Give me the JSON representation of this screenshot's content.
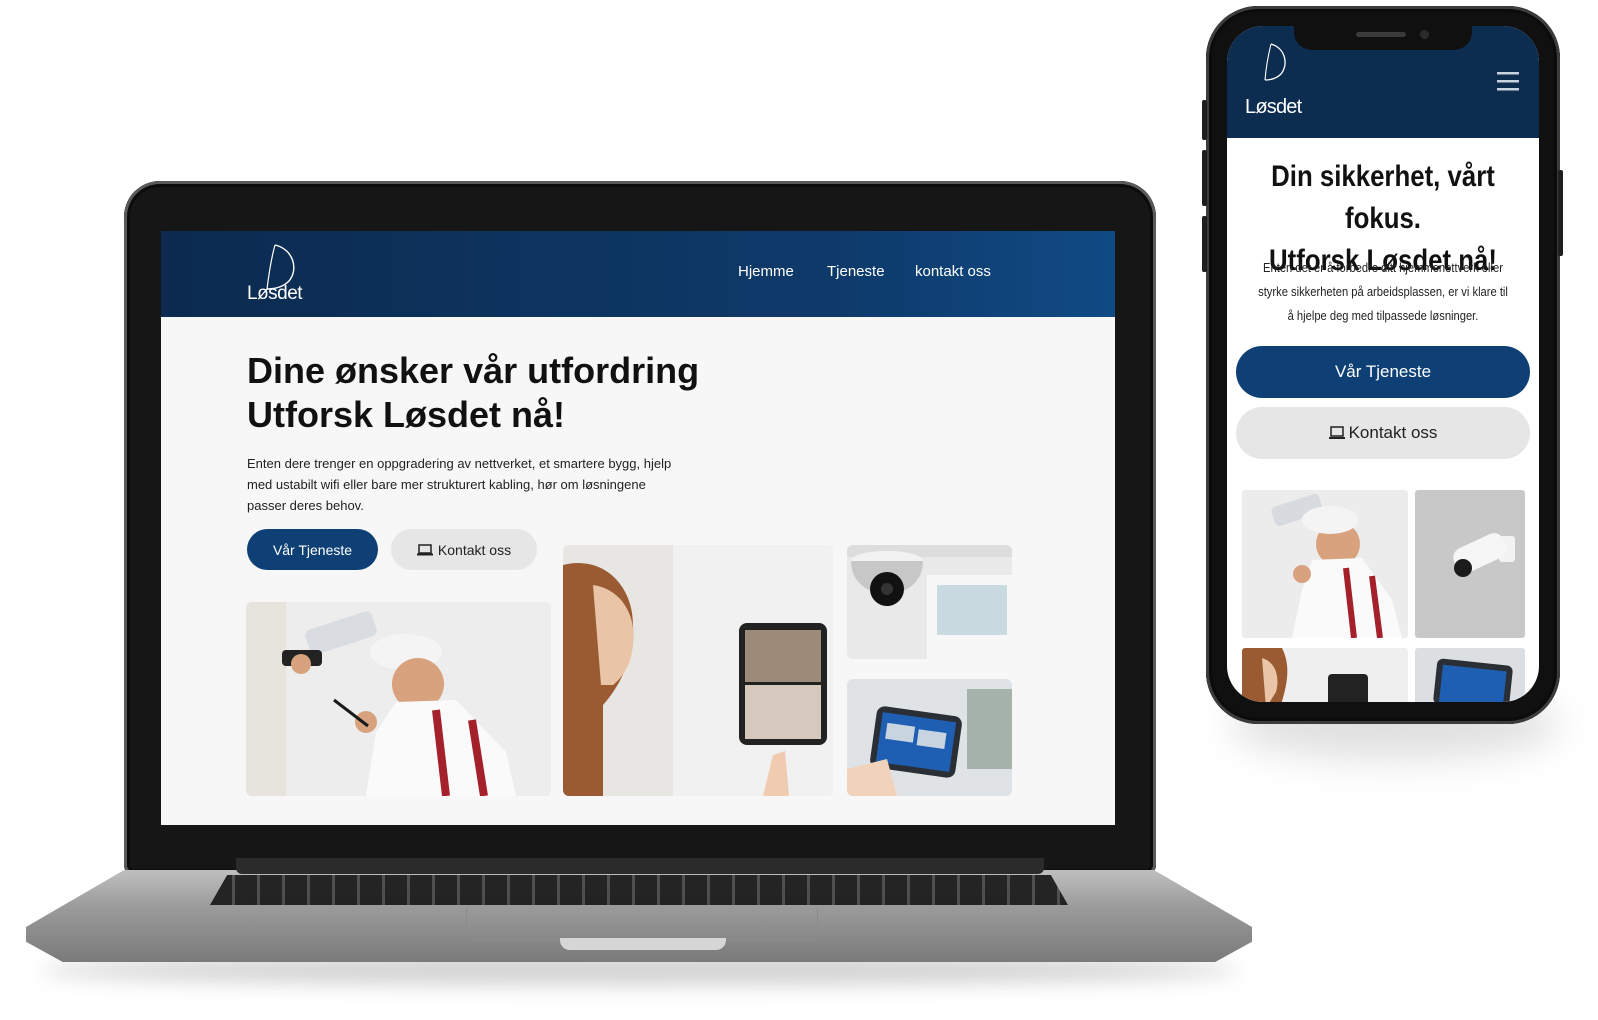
{
  "brand": {
    "name": "Løsdet",
    "primary": "#0f4075",
    "header_bg": "#0c2a4f",
    "light_button_bg": "#e6e6e6"
  },
  "desktop": {
    "nav": {
      "items": [
        "Hjemme",
        "Tjeneste",
        "kontakt oss"
      ]
    },
    "hero": {
      "title_line1": "Dine ønsker vår utfordring",
      "title_line2": "Utforsk Løsdet nå!",
      "text": "Enten dere trenger en oppgradering av nettverket, et smartere bygg, hjelp med ustabilt wifi eller bare mer strukturert kabling, hør om løsningene passer deres behov.",
      "primary_button": "Vår Tjeneste",
      "secondary_button": "Kontakt oss",
      "secondary_icon": "laptop-icon"
    },
    "gallery_icons": [
      "technician-camera-photo",
      "woman-tablet-photo",
      "dome-camera-photo",
      "tablet-security-app-photo"
    ]
  },
  "mobile": {
    "menu_icon": "hamburger-menu-icon",
    "hero": {
      "title_line1": "Din sikkerhet, vårt fokus.",
      "title_line2": "Utforsk Løsdet nå!",
      "text": "Enten det er å forbedre ditt hjemmenettverk eller styrke sikkerheten på arbeidsplassen, er vi klare til å hjelpe deg med tilpassede løsninger.",
      "primary_button": "Vår Tjeneste",
      "secondary_button": "Kontakt oss",
      "secondary_icon": "laptop-icon"
    }
  }
}
